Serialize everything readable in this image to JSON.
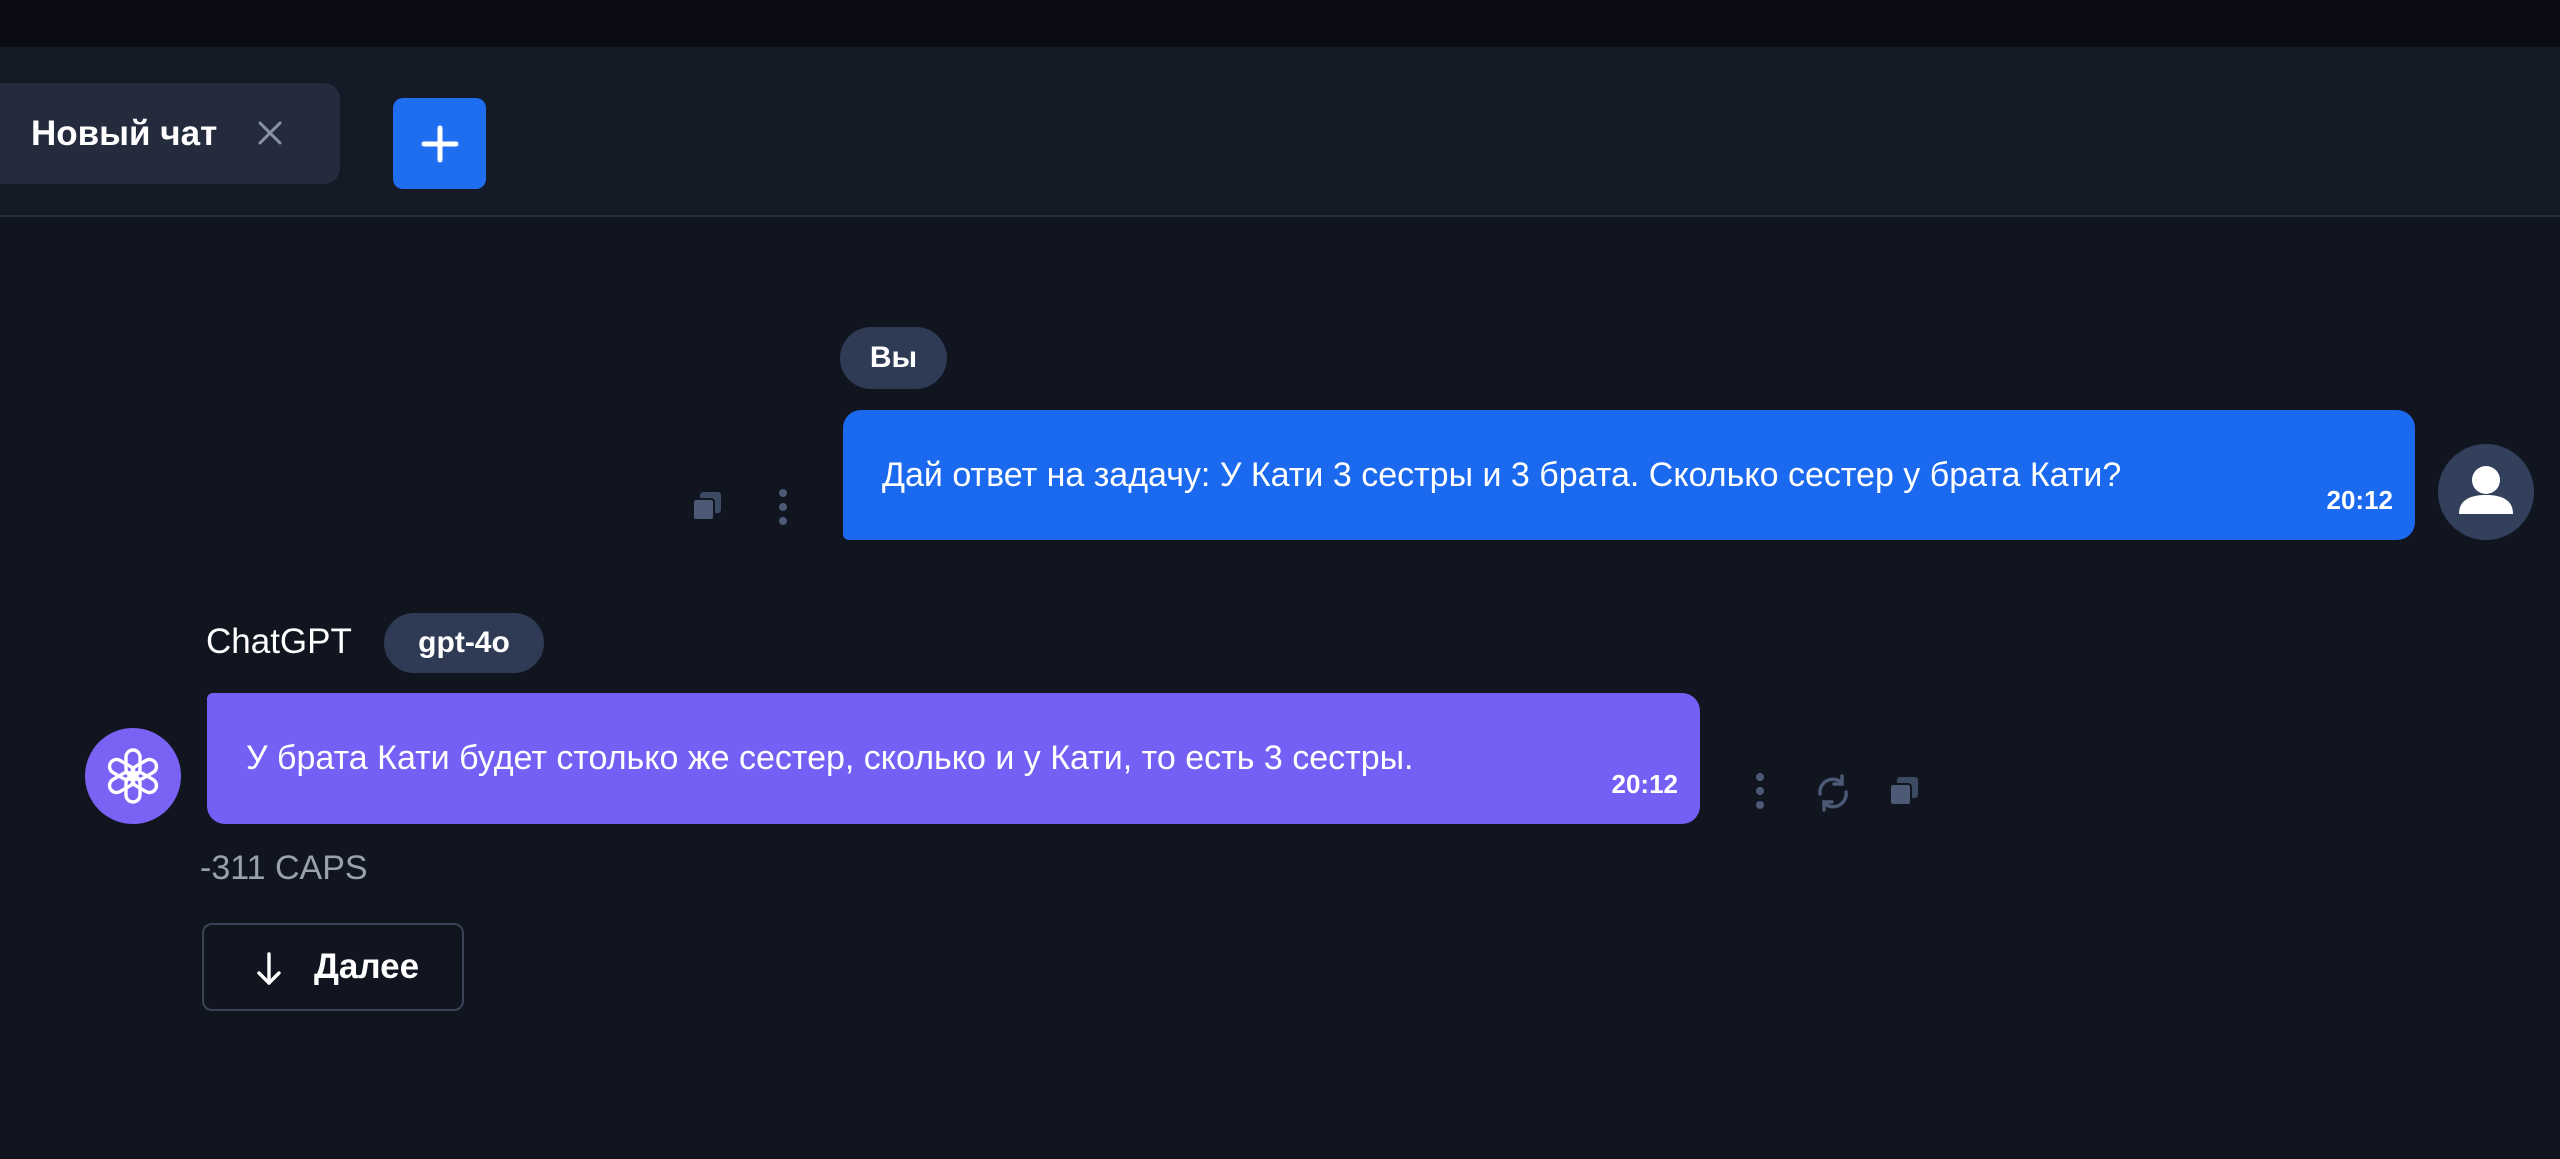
{
  "tabs": [
    {
      "label": "Новый чат",
      "active": true
    }
  ],
  "new_chat_button": {
    "icon": "plus-icon"
  },
  "messages": [
    {
      "role": "user",
      "sender_label": "Вы",
      "text": "Дай ответ на задачу: У Кати 3 сестры и 3 брата. Сколько сестер у брата Кати?",
      "time": "20:12"
    },
    {
      "role": "assistant",
      "sender_name": "ChatGPT",
      "model": "gpt-4o",
      "text": "У брата Кати будет столько же сестер, сколько и у Кати, то есть 3 сестры.",
      "time": "20:12",
      "cost": "-311 CAPS"
    }
  ],
  "next_button": {
    "label": "Далее",
    "icon": "arrow-down-icon"
  },
  "colors": {
    "background": "#111520",
    "user_bubble": "#1a69ee",
    "assistant_bubble": "#7560f6",
    "accent": "#1f6ef0"
  }
}
